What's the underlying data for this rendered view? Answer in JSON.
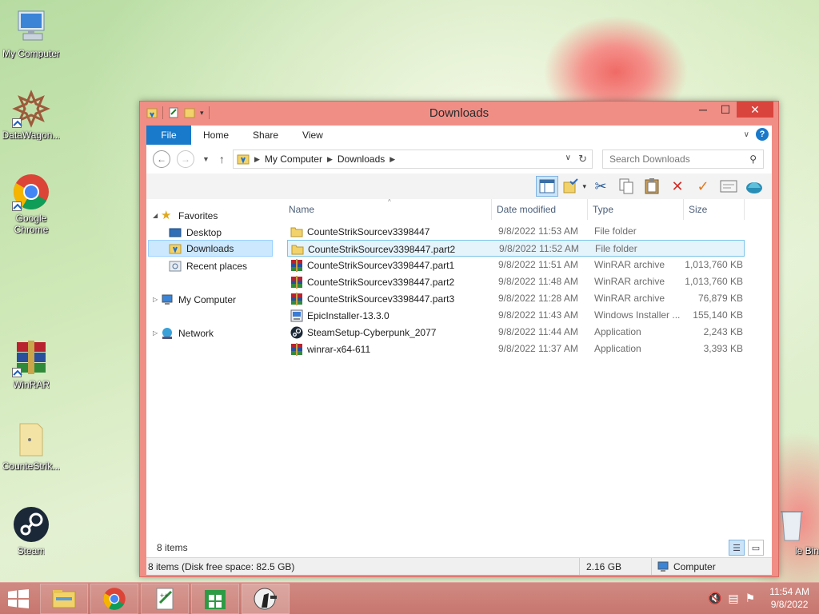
{
  "desktop": {
    "icons": [
      {
        "label": "My Computer"
      },
      {
        "label": "DataWagon..."
      },
      {
        "label": "Google Chrome"
      },
      {
        "label": "WinRAR"
      },
      {
        "label": "CounteStrik..."
      },
      {
        "label": "Steam"
      },
      {
        "label": "le Bin"
      }
    ]
  },
  "window": {
    "title": "Downloads",
    "tabs": [
      "File",
      "Home",
      "Share",
      "View"
    ],
    "address": {
      "crumbs": [
        "My Computer",
        "Downloads"
      ]
    },
    "search": {
      "placeholder": "Search Downloads"
    }
  },
  "nav": {
    "favorites": "Favorites",
    "desktop": "Desktop",
    "downloads": "Downloads",
    "recent": "Recent places",
    "my_computer": "My Computer",
    "network": "Network"
  },
  "columns": [
    "Name",
    "Date modified",
    "Type",
    "Size"
  ],
  "files": [
    {
      "name": "CounteStrikSourcev3398447",
      "date": "9/8/2022 11:53 AM",
      "type": "File folder",
      "size": "",
      "icon": "folder-icon"
    },
    {
      "name": "CounteStrikSourcev3398447.part2",
      "date": "9/8/2022 11:52 AM",
      "type": "File folder",
      "size": "",
      "icon": "folder-icon"
    },
    {
      "name": "CounteStrikSourcev3398447.part1",
      "date": "9/8/2022 11:51 AM",
      "type": "WinRAR archive",
      "size": "1,013,760 KB",
      "icon": "winrar-icon"
    },
    {
      "name": "CounteStrikSourcev3398447.part2",
      "date": "9/8/2022 11:48 AM",
      "type": "WinRAR archive",
      "size": "1,013,760 KB",
      "icon": "winrar-icon"
    },
    {
      "name": "CounteStrikSourcev3398447.part3",
      "date": "9/8/2022 11:28 AM",
      "type": "WinRAR archive",
      "size": "76,879 KB",
      "icon": "winrar-icon"
    },
    {
      "name": "EpicInstaller-13.3.0",
      "date": "9/8/2022 11:43 AM",
      "type": "Windows Installer ...",
      "size": "155,140 KB",
      "icon": "installer-icon"
    },
    {
      "name": "SteamSetup-Cyberpunk_2077",
      "date": "9/8/2022 11:44 AM",
      "type": "Application",
      "size": "2,243 KB",
      "icon": "steam-icon"
    },
    {
      "name": "winrar-x64-611",
      "date": "9/8/2022 11:37 AM",
      "type": "Application",
      "size": "3,393 KB",
      "icon": "winrar-icon"
    }
  ],
  "status": {
    "item_count": "8 items",
    "disk": "8 items (Disk free space: 82.5 GB)",
    "size": "2.16 GB",
    "location": "Computer"
  },
  "taskbar": {
    "time": "11:54 AM",
    "date": "9/8/2022"
  },
  "colors": {
    "window_frame": "#f08e86",
    "accent": "#1979ca",
    "selection": "#cce8ff",
    "close": "#d9443c"
  }
}
